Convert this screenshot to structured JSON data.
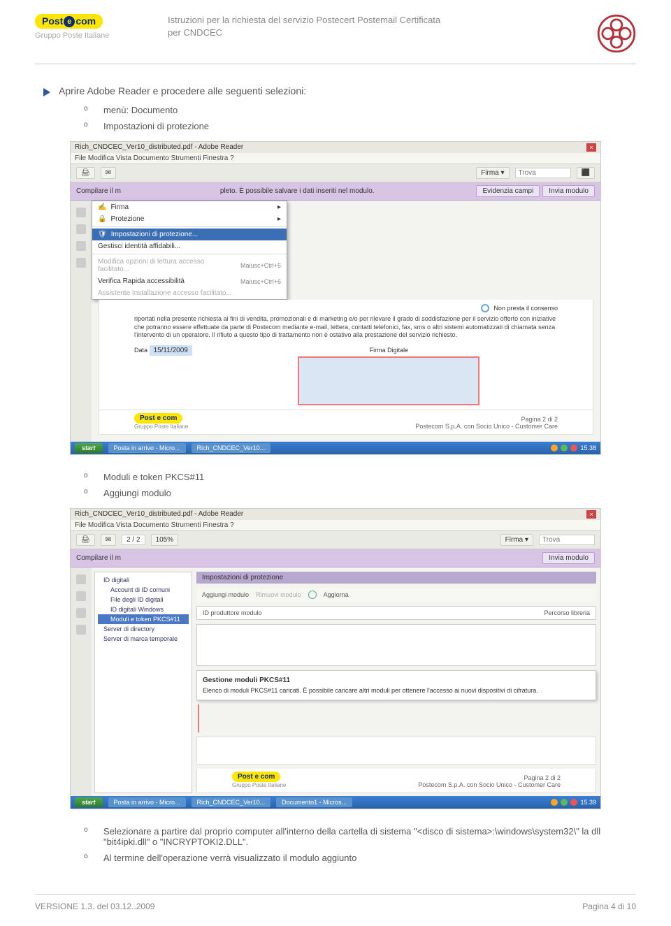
{
  "header": {
    "logo_text_pre": "Post",
    "logo_text_post": "com",
    "gruppo": "Gruppo Poste Italiane",
    "title_line1": "Istruzioni per la richiesta del servizio Postecert Postemail Certificata",
    "title_line2": "per CNDCEC"
  },
  "section1": {
    "heading": "Aprire Adobe Reader e procedere alle seguenti selezioni:",
    "bullets": [
      "menù: Documento",
      "Impostazioni di protezione"
    ]
  },
  "screenshot1": {
    "titlebar": "Rich_CNDCEC_Ver10_distributed.pdf - Adobe Reader",
    "menubar": "File  Modifica  Vista  Documento  Strumenti  Finestra  ?",
    "toolbar": {
      "firma": "Firma ▾",
      "trova": "Trova"
    },
    "purple_left": "Compilare il m",
    "purple_msg": "pleto. È possibile salvare i dati inseriti nel modulo.",
    "purple_btn1": "Evidenzia campi",
    "purple_btn2": "Invia modulo",
    "menu": {
      "item_firma": "Firma",
      "item_protezione": "Protezione",
      "item_impostazioni": "Impostazioni di protezione...",
      "item_gestisci": "Gestisci identità affidabili...",
      "item_modifica": "Modifica opzioni di lettura accesso facilitato...",
      "item_modifica_kbd": "Maiusc+Ctrl+5",
      "item_verifica": "Verifica Rapida accessibilità",
      "item_verifica_kbd": "Maiusc+Ctrl+6",
      "item_assistente": "Assistente Installazione accesso facilitato..."
    },
    "doc": {
      "consent": "Non presta il consenso",
      "body": "riportati nella presente richiesta ai fini di vendita, promozionali e di marketing e/o per rilevare il grado di soddisfazione per il servizio offerto con iniziative che potranno essere effettuate da parte di Postecom mediante e-mail, lettera, contatti telefonici, fax, sms o altri sistemi automatizzati di chiamata senza l'intervento di un operatore. Il rifiuto a questo tipo di trattamento non è ostativo alla prestazione del servizio richiesto.",
      "data_label": "Data",
      "data_value": "15/11/2009",
      "firma_label": "Firma Digitale"
    },
    "docfooter": {
      "logo": "Post e com",
      "gruppo": "Gruppo Poste Italiane",
      "page": "Pagina 2 di 2",
      "company": "Postecom S.p.A. con Socio Unico - Customer Care"
    },
    "taskbar": {
      "start": "start",
      "t1": "Posta in arrivo - Micro...",
      "t2": "Rich_CNDCEC_Ver10...",
      "clock": "15.38"
    }
  },
  "section2": {
    "bullets": [
      "Moduli e token PKCS#11",
      "Aggiungi modulo"
    ]
  },
  "screenshot2": {
    "titlebar": "Rich_CNDCEC_Ver10_distributed.pdf - Adobe Reader",
    "menubar": "File  Modifica  Vista  Documento  Strumenti  Finestra  ?",
    "toolbar_page": "2 / 2",
    "toolbar_zoom": "105%",
    "purple_left": "Compilare il m",
    "purple_btn": "Invia modulo",
    "sectitle": "Impostazioni di protezione",
    "tree": [
      {
        "label": "ID digitali",
        "indent": false,
        "sel": false
      },
      {
        "label": "Account di ID comuni",
        "indent": true,
        "sel": false
      },
      {
        "label": "File degli ID digitali",
        "indent": true,
        "sel": false
      },
      {
        "label": "ID digitali Windows",
        "indent": true,
        "sel": false
      },
      {
        "label": "Moduli e token PKCS#11",
        "indent": true,
        "sel": true
      },
      {
        "label": "Server di directory",
        "indent": false,
        "sel": false
      },
      {
        "label": "Server di marca temporale",
        "indent": false,
        "sel": false
      }
    ],
    "tools": {
      "aggiungi": "Aggiungi modulo",
      "rimuovi": "Rimuovi modulo",
      "aggiorna": "Aggiorna",
      "idprod": "ID produttore modulo",
      "percorso": "Percorso libreria"
    },
    "pkcs": {
      "title": "Gestione moduli PKCS#11",
      "body": "Elenco di moduli PKCS#11 caricati. È possibile caricare altri moduli per ottenere l'accesso ai nuovi dispositivi di cifratura."
    },
    "docfooter": {
      "logo": "Post e com",
      "gruppo": "Gruppo Poste Italiane",
      "page": "Pagina 2 di 2",
      "company": "Postecom S.p.A. con Socio Unico - Customer Care"
    },
    "taskbar": {
      "start": "start",
      "t1": "Posta in arrivo - Micro...",
      "t2": "Rich_CNDCEC_Ver10...",
      "t3": "Documento1 - Micros...",
      "clock": "15.39"
    }
  },
  "section3": {
    "bullets": [
      "Selezionare a partire dal proprio computer all'interno della cartella di sistema \"<disco di sistema>:\\windows\\system32\\\" la dll \"bit4ipki.dll\" o \"INCRYPTOKI2.DLL\".",
      "Al termine dell'operazione verrà visualizzato il modulo aggiunto"
    ]
  },
  "footer": {
    "left": "VERSIONE 1.3. del 03.12..2009",
    "right": "Pagina 4 di 10"
  }
}
